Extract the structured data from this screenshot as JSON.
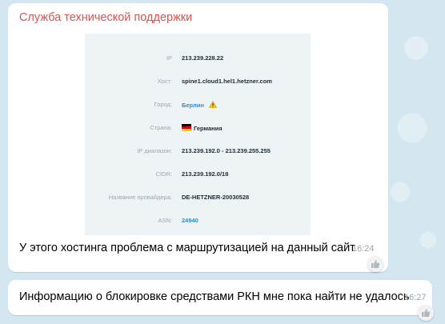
{
  "chat": {
    "sender_name": "Служба технической поддержки",
    "messages": [
      {
        "text": "У этого хостинга проблема с маршрутизацией на данный сайт",
        "time": "16:24"
      },
      {
        "text": "Информацию о блокировке средствами РКН мне пока найти не удалось",
        "time": "16:27"
      }
    ]
  },
  "ip_info": {
    "rows": [
      {
        "label": "IP",
        "value": "213.239.228.22"
      },
      {
        "label": "Хост:",
        "value": "spine1.cloud1.hel1.hetzner.com"
      },
      {
        "label": "Город:",
        "value": "Берлин"
      },
      {
        "label": "Страна:",
        "value": "Германия"
      },
      {
        "label": "IP диапазон:",
        "value": "213.239.192.0 - 213.239.255.255"
      },
      {
        "label": "CIDR:",
        "value": "213.239.192.0/18"
      },
      {
        "label": "Название провайдера:",
        "value": "DE-HETZNER-20030528"
      },
      {
        "label": "ASN:",
        "value": "24940"
      }
    ]
  },
  "icons": {
    "city_warning": "warning-icon",
    "country_flag": "germany-flag-icon",
    "reaction": "thumbs-up-icon"
  },
  "colors": {
    "sender": "#d9534f",
    "link": "#2a8fd8",
    "background": "#d4e6f0"
  }
}
